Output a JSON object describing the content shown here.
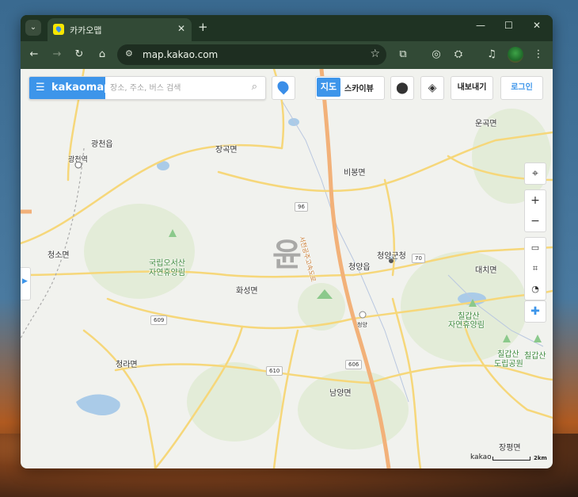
{
  "browser": {
    "tab_title": "카카오맵",
    "url": "map.kakao.com",
    "new_tab": "+",
    "tab_close": "✕",
    "min": "—",
    "max": "☐",
    "close": "✕"
  },
  "map": {
    "brand": "kakaomap",
    "search_placeholder": "장소, 주소, 버스 검색",
    "maptype_map": "지도",
    "maptype_sky": "스카이뷰",
    "export_label": "내보내기",
    "login_label": "로그인",
    "watermark": "윤",
    "scale_brand": "kakao",
    "scale_unit": "2km"
  },
  "places": {
    "gwangcheon_eup": "광천읍",
    "gwangcheon_station": "광천역",
    "janggok": "장곡면",
    "bibong": "비봉면",
    "ungok": "운곡면",
    "cheongso": "청소면",
    "ohseosan_1": "국립오서산",
    "ohseosan_2": "자연휴양림",
    "hwaseong": "화성면",
    "cheongyang_eup": "청양읍",
    "cheongyang_gun": "청양군청",
    "daechi": "대치면",
    "chilgapsan_1": "칠갑산",
    "chilgapsan_2": "자연휴양림",
    "chilgapsan_park_1": "칠갑산",
    "chilgapsan_park_2": "도립공원",
    "chilgapsan_peak": "칠갑산",
    "cheongna": "청라면",
    "namyang": "남양면",
    "jangpyeong": "장평면",
    "cheongyang_small": "청양",
    "expressway": "서천공주고속도로"
  },
  "roads": {
    "r96": "96",
    "r70": "70",
    "r609": "609",
    "r610": "610",
    "r606": "606"
  }
}
